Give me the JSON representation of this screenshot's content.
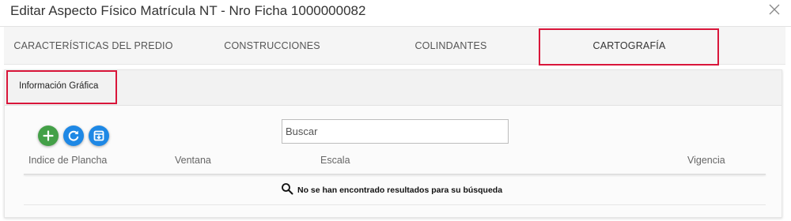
{
  "modal": {
    "title": "Editar Aspecto Físico Matrícula NT - Nro Ficha 1000000082"
  },
  "tabs": [
    {
      "label": "CARACTERÍSTICAS DEL PREDIO"
    },
    {
      "label": "CONSTRUCCIONES"
    },
    {
      "label": "COLINDANTES"
    },
    {
      "label": "CARTOGRAFÍA",
      "active": true
    }
  ],
  "panel": {
    "header_label": "Información Gráfica"
  },
  "toolbar": {
    "add_icon": "plus-icon",
    "refresh_icon": "refresh-icon",
    "export_icon": "archive-icon"
  },
  "search": {
    "placeholder": "Buscar",
    "value": ""
  },
  "table": {
    "columns": [
      "Indice de Plancha",
      "Ventana",
      "Escala",
      "Vigencia"
    ],
    "rows": [],
    "empty_message": "No se han encontrado resultados para su búsqueda"
  },
  "colors": {
    "highlight": "#d9163a",
    "add": "#43a047",
    "primary": "#1e88e5"
  }
}
